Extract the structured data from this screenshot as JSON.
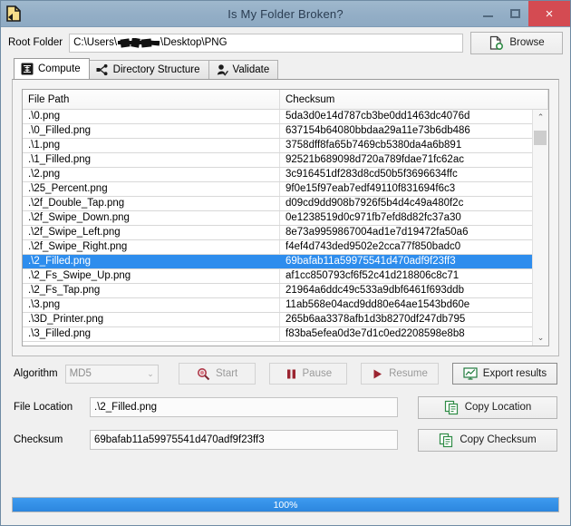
{
  "window": {
    "title": "Is My Folder Broken?",
    "icon": "document-icon",
    "minimize_label": "Minimize",
    "maximize_label": "Maximize",
    "close_label": "×"
  },
  "root_folder": {
    "label": "Root Folder",
    "value_prefix": "C:\\Users\\",
    "value_suffix": "\\Desktop\\PNG",
    "redacted": true,
    "browse_label": "Browse",
    "browse_icon": "folder-page-icon"
  },
  "tabs": [
    {
      "label": "Compute",
      "icon": "compute-icon",
      "active": true
    },
    {
      "label": "Directory Structure",
      "icon": "tree-icon",
      "active": false
    },
    {
      "label": "Validate",
      "icon": "user-check-icon",
      "active": false
    }
  ],
  "listview": {
    "columns": [
      "File Path",
      "Checksum"
    ],
    "selected_index": 10,
    "rows": [
      {
        "path": ".\\0.png",
        "checksum": "5da3d0e14d787cb3be0dd1463dc4076d"
      },
      {
        "path": ".\\0_Filled.png",
        "checksum": "637154b64080bbdaa29a11e73b6db486"
      },
      {
        "path": ".\\1.png",
        "checksum": "3758dff8fa65b7469cb5380da4a6b891"
      },
      {
        "path": ".\\1_Filled.png",
        "checksum": "92521b689098d720a789fdae71fc62ac"
      },
      {
        "path": ".\\2.png",
        "checksum": "3c916451df283d8cd50b5f3696634ffc"
      },
      {
        "path": ".\\25_Percent.png",
        "checksum": "9f0e15f97eab7edf49110f831694f6c3"
      },
      {
        "path": ".\\2f_Double_Tap.png",
        "checksum": "d09cd9dd908b7926f5b4d4c49a480f2c"
      },
      {
        "path": ".\\2f_Swipe_Down.png",
        "checksum": "0e1238519d0c971fb7efd8d82fc37a30"
      },
      {
        "path": ".\\2f_Swipe_Left.png",
        "checksum": "8e73a9959867004ad1e7d19472fa50a6"
      },
      {
        "path": ".\\2f_Swipe_Right.png",
        "checksum": "f4ef4d743ded9502e2cca77f850badc0"
      },
      {
        "path": ".\\2_Filled.png",
        "checksum": "69bafab11a59975541d470adf9f23ff3"
      },
      {
        "path": ".\\2_Fs_Swipe_Up.png",
        "checksum": "af1cc850793cf6f52c41d218806c8c71"
      },
      {
        "path": ".\\2_Fs_Tap.png",
        "checksum": "21964a6ddc49c533a9dbf6461f693ddb"
      },
      {
        "path": ".\\3.png",
        "checksum": "11ab568e04acd9dd80e64ae1543bd60e"
      },
      {
        "path": ".\\3D_Printer.png",
        "checksum": "265b6aa3378afb1d3b8270df247db795"
      },
      {
        "path": ".\\3_Filled.png",
        "checksum": "f83ba5efea0d3e7d1c0ed2208598e8b8"
      }
    ],
    "scroll_up_glyph": "⌃",
    "scroll_down_glyph": "⌄"
  },
  "controls": {
    "algorithm_label": "Algorithm",
    "algorithm_value": "MD5",
    "caret_glyph": "⌄",
    "start_label": "Start",
    "start_icon": "magnifier-icon",
    "start_enabled": false,
    "pause_label": "Pause",
    "pause_icon": "pause-icon",
    "pause_enabled": false,
    "resume_label": "Resume",
    "resume_icon": "play-icon",
    "resume_enabled": false,
    "export_label": "Export results",
    "export_icon": "chart-export-icon"
  },
  "details": {
    "file_location_label": "File Location",
    "file_location_value": ".\\2_Filled.png",
    "copy_location_label": "Copy Location",
    "copy_location_icon": "copy-icon",
    "checksum_label": "Checksum",
    "checksum_value": "69bafab11a59975541d470adf9f23ff3",
    "copy_checksum_label": "Copy Checksum",
    "copy_checksum_icon": "copy-icon"
  },
  "progress": {
    "percent": 100,
    "text": "100%",
    "color": "#2e8ded"
  }
}
